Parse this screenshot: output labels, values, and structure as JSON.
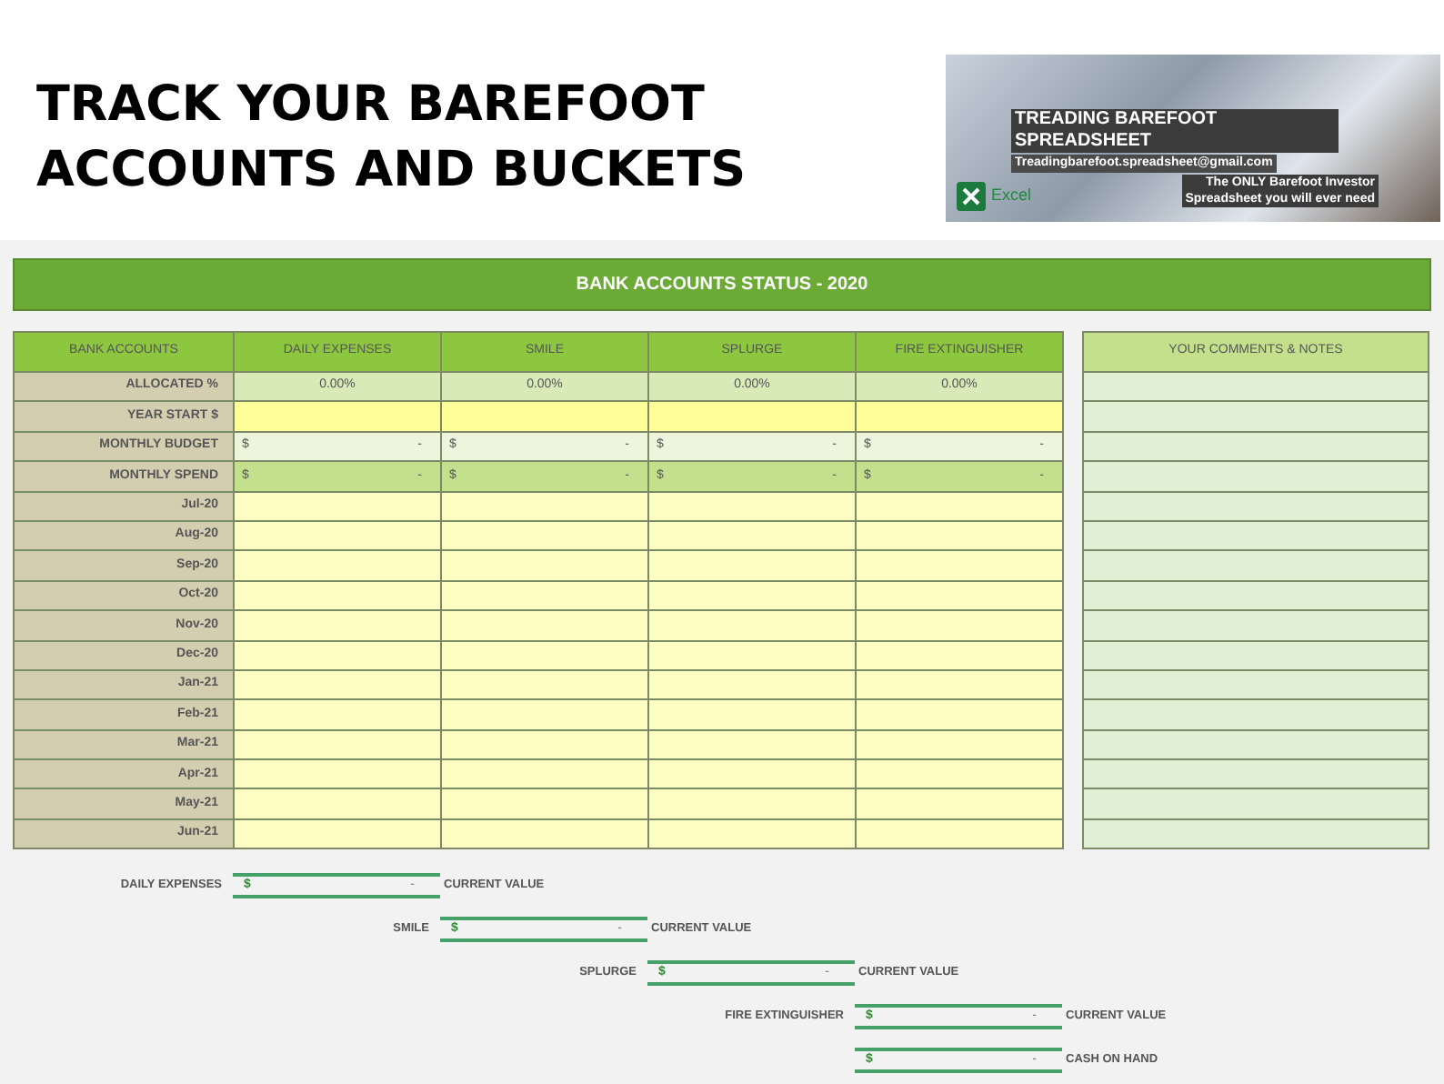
{
  "heading": {
    "lines": [
      "TRACK YOUR BAREFOOT",
      "ACCOUNTS AND BUCKETS"
    ]
  },
  "banner": {
    "title": "TREADING BAREFOOT SPREADSHEET",
    "email": "Treadingbarefoot.spreadsheet@gmail.com",
    "app": "Excel",
    "tagline": [
      "The ONLY Barefoot Investor",
      "Spreadsheet you will ever need"
    ]
  },
  "title_bar": "BANK ACCOUNTS STATUS - 2020",
  "table": {
    "columns": [
      "BANK ACCOUNTS",
      "DAILY EXPENSES",
      "SMILE",
      "SPLURGE",
      "FIRE EXTINGUISHER"
    ],
    "rows": [
      {
        "label": "ALLOCATED %",
        "kind": "percent",
        "cells": [
          "0.00%",
          "0.00%",
          "0.00%",
          "0.00%"
        ]
      },
      {
        "label": "YEAR START $",
        "kind": "input"
      },
      {
        "label": "MONTHLY BUDGET",
        "kind": "budget",
        "cells": [
          {
            "symbol": "$",
            "value": "-"
          },
          {
            "symbol": "$",
            "value": "-"
          },
          {
            "symbol": "$",
            "value": "-"
          },
          {
            "symbol": "$",
            "value": "-"
          }
        ]
      },
      {
        "label": "MONTHLY SPEND",
        "kind": "spend",
        "cells": [
          {
            "symbol": "$",
            "value": "-"
          },
          {
            "symbol": "$",
            "value": "-"
          },
          {
            "symbol": "$",
            "value": "-"
          },
          {
            "symbol": "$",
            "value": "-"
          }
        ]
      },
      {
        "label": "Jul-20",
        "kind": "month"
      },
      {
        "label": "Aug-20",
        "kind": "month"
      },
      {
        "label": "Sep-20",
        "kind": "month"
      },
      {
        "label": "Oct-20",
        "kind": "month"
      },
      {
        "label": "Nov-20",
        "kind": "month"
      },
      {
        "label": "Dec-20",
        "kind": "month"
      },
      {
        "label": "Jan-21",
        "kind": "month"
      },
      {
        "label": "Feb-21",
        "kind": "month"
      },
      {
        "label": "Mar-21",
        "kind": "month"
      },
      {
        "label": "Apr-21",
        "kind": "month"
      },
      {
        "label": "May-21",
        "kind": "month"
      },
      {
        "label": "Jun-21",
        "kind": "month"
      }
    ]
  },
  "notes": {
    "title": "YOUR COMMENTS & NOTES"
  },
  "summary": [
    {
      "label": "DAILY EXPENSES",
      "symbol": "$",
      "value": "-",
      "caption": "CURRENT VALUE"
    },
    {
      "label": "SMILE",
      "symbol": "$",
      "value": "-",
      "caption": "CURRENT VALUE"
    },
    {
      "label": "SPLURGE",
      "symbol": "$",
      "value": "-",
      "caption": "CURRENT VALUE"
    },
    {
      "label": "FIRE EXTINGUISHER",
      "symbol": "$",
      "value": "-",
      "caption": "CURRENT VALUE"
    },
    {
      "symbol": "$",
      "value": "-",
      "caption": "CASH ON HAND"
    }
  ]
}
